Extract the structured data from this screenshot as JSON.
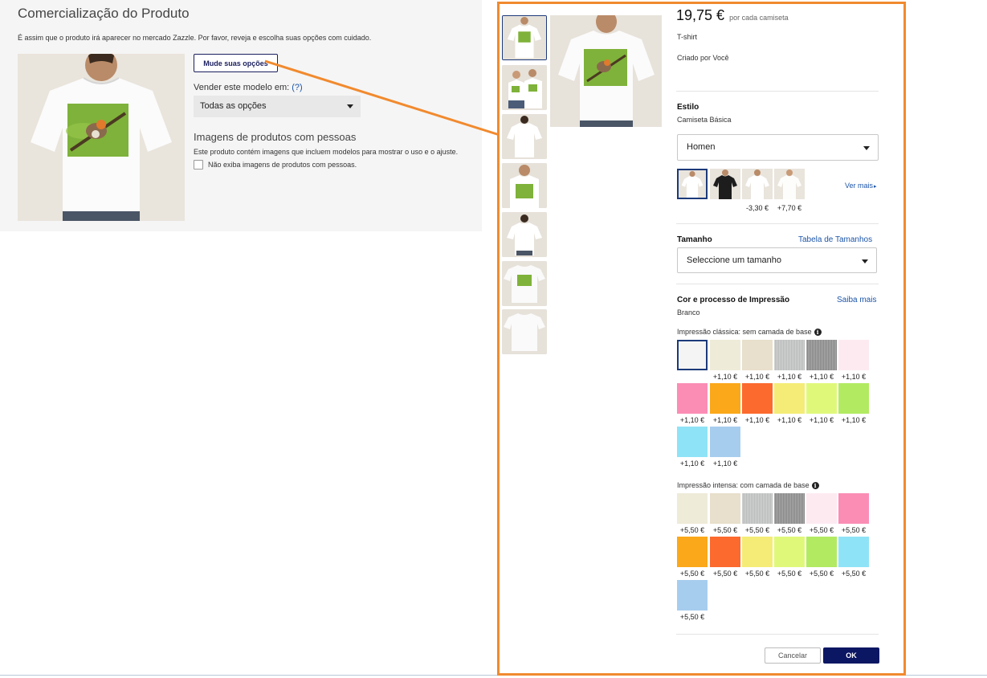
{
  "left": {
    "title": "Comercialização do Produto",
    "description": "É assim que o produto irá aparecer no mercado Zazzle. Por favor, reveja e escolha suas opções com cuidado.",
    "change_options_label": "Mude suas opções",
    "sell_label": "Vender este modelo em:",
    "sell_help": "(?)",
    "sell_value": "Todas as opções",
    "people_heading": "Imagens de produtos com pessoas",
    "people_desc": "Este produto contém imagens que incluem modelos para mostrar o uso e o ajuste.",
    "people_checkbox_label": "Não exiba imagens de produtos com pessoas."
  },
  "product": {
    "price": "19,75 €",
    "price_unit": "por cada camiseta",
    "type": "T-shirt",
    "created_by_label": "Criado por",
    "created_by": "Você"
  },
  "style": {
    "title": "Estilo",
    "value": "Camiseta Básica",
    "gender_value": "Homen",
    "see_more": "Ver mais",
    "swatches": [
      {
        "name": "white-tee",
        "price": ""
      },
      {
        "name": "black-tee",
        "price": ""
      },
      {
        "name": "white-tee-2",
        "price": "-3,30 €"
      },
      {
        "name": "white-tee-3",
        "price": "+7,70 €"
      }
    ]
  },
  "size": {
    "title": "Tamanho",
    "chart_link": "Tabela de Tamanhos",
    "placeholder": "Seleccione um tamanho"
  },
  "color": {
    "title": "Cor e processo de Impressão",
    "learn_more": "Saiba mais",
    "value": "Branco",
    "classic_label": "Impressão clássica: sem camada de base",
    "intense_label": "Impressão intensa: com camada de base",
    "classic": [
      {
        "color": "#f4f4f4",
        "price": ""
      },
      {
        "color": "#eeebd9",
        "price": "+1,10 €"
      },
      {
        "color": "#e8dfcc",
        "price": "+1,10 €"
      },
      {
        "color": "#c3c5c5",
        "price": "+1,10 €"
      },
      {
        "color": "#8e8e8e",
        "price": "+1,10 €"
      },
      {
        "color": "#fdeaf1",
        "price": "+1,10 €"
      },
      {
        "color": "#fb8db5",
        "price": "+1,10 €"
      },
      {
        "color": "#fba81a",
        "price": "+1,10 €"
      },
      {
        "color": "#fc6a2e",
        "price": "+1,10 €"
      },
      {
        "color": "#f4ec76",
        "price": "+1,10 €"
      },
      {
        "color": "#e0f87a",
        "price": "+1,10 €"
      },
      {
        "color": "#b2ea62",
        "price": "+1,10 €"
      },
      {
        "color": "#8fe3f6",
        "price": "+1,10 €"
      },
      {
        "color": "#a7cdee",
        "price": "+1,10 €"
      }
    ],
    "intense": [
      {
        "color": "#eeebd9",
        "price": "+5,50 €"
      },
      {
        "color": "#e8dfcc",
        "price": "+5,50 €"
      },
      {
        "color": "#c3c5c5",
        "price": "+5,50 €"
      },
      {
        "color": "#8e8e8e",
        "price": "+5,50 €"
      },
      {
        "color": "#fdeaf1",
        "price": "+5,50 €"
      },
      {
        "color": "#fb8db5",
        "price": "+5,50 €"
      },
      {
        "color": "#fba81a",
        "price": "+5,50 €"
      },
      {
        "color": "#fc6a2e",
        "price": "+5,50 €"
      },
      {
        "color": "#f4ec76",
        "price": "+5,50 €"
      },
      {
        "color": "#e0f87a",
        "price": "+5,50 €"
      },
      {
        "color": "#b2ea62",
        "price": "+5,50 €"
      },
      {
        "color": "#8fe3f6",
        "price": "+5,50 €"
      },
      {
        "color": "#a7cdee",
        "price": "+5,50 €"
      }
    ]
  },
  "actions": {
    "cancel": "Cancelar",
    "ok": "OK"
  },
  "colors": {
    "accent_orange": "#f18a2e",
    "brand_navy": "#0c1763",
    "link_blue": "#1c55a8"
  }
}
